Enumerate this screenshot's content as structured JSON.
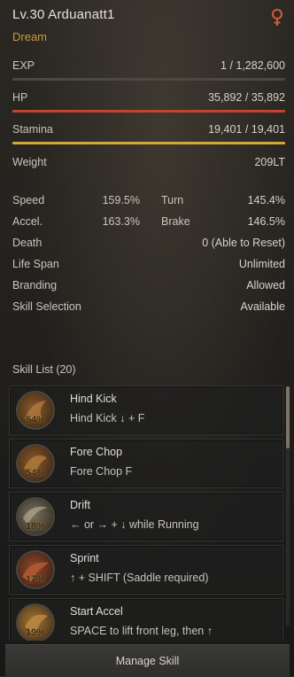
{
  "header": {
    "title": "Lv.30 Arduanatt1",
    "subtitle": "Dream",
    "gender_icon": "female-icon",
    "gender_color": "#d45a3a"
  },
  "stats": {
    "exp_label": "EXP",
    "exp_value": "1 / 1,282,600",
    "exp_fill": 0.0,
    "hp_label": "HP",
    "hp_value": "35,892 / 35,892",
    "hp_fill": 1.0,
    "hp_color": "#c2442c",
    "stamina_label": "Stamina",
    "stamina_value": "19,401 / 19,401",
    "stamina_fill": 1.0,
    "stamina_color": "#d1a93a",
    "weight_label": "Weight",
    "weight_value": "209LT",
    "speed_label": "Speed",
    "speed_value": "159.5%",
    "turn_label": "Turn",
    "turn_value": "145.4%",
    "accel_label": "Accel.",
    "accel_value": "163.3%",
    "brake_label": "Brake",
    "brake_value": "146.5%",
    "death_label": "Death",
    "death_value": "0 (Able to Reset)",
    "lifespan_label": "Life Span",
    "lifespan_value": "Unlimited",
    "branding_label": "Branding",
    "branding_value": "Allowed",
    "skillsel_label": "Skill Selection",
    "skillsel_value": "Available"
  },
  "skill_list": {
    "title": "Skill List (20)",
    "items": [
      {
        "name": "Hind Kick",
        "command": "Hind Kick ↓ + F",
        "percent": "54%",
        "icon": "hind-kick-icon"
      },
      {
        "name": "Fore Chop",
        "command": "Fore Chop F",
        "percent": "54%",
        "icon": "fore-chop-icon"
      },
      {
        "name": "Drift",
        "command": "← or → + ↓ while Running",
        "percent": "18%",
        "icon": "drift-icon"
      },
      {
        "name": "Sprint",
        "command": "↑ + SHIFT (Saddle required)",
        "percent": "17%",
        "icon": "sprint-icon"
      },
      {
        "name": "Start Accel",
        "command": "SPACE to lift front leg, then ↑",
        "percent": "19%",
        "icon": "start-accel-icon"
      }
    ]
  },
  "footer": {
    "manage_label": "Manage Skill"
  }
}
